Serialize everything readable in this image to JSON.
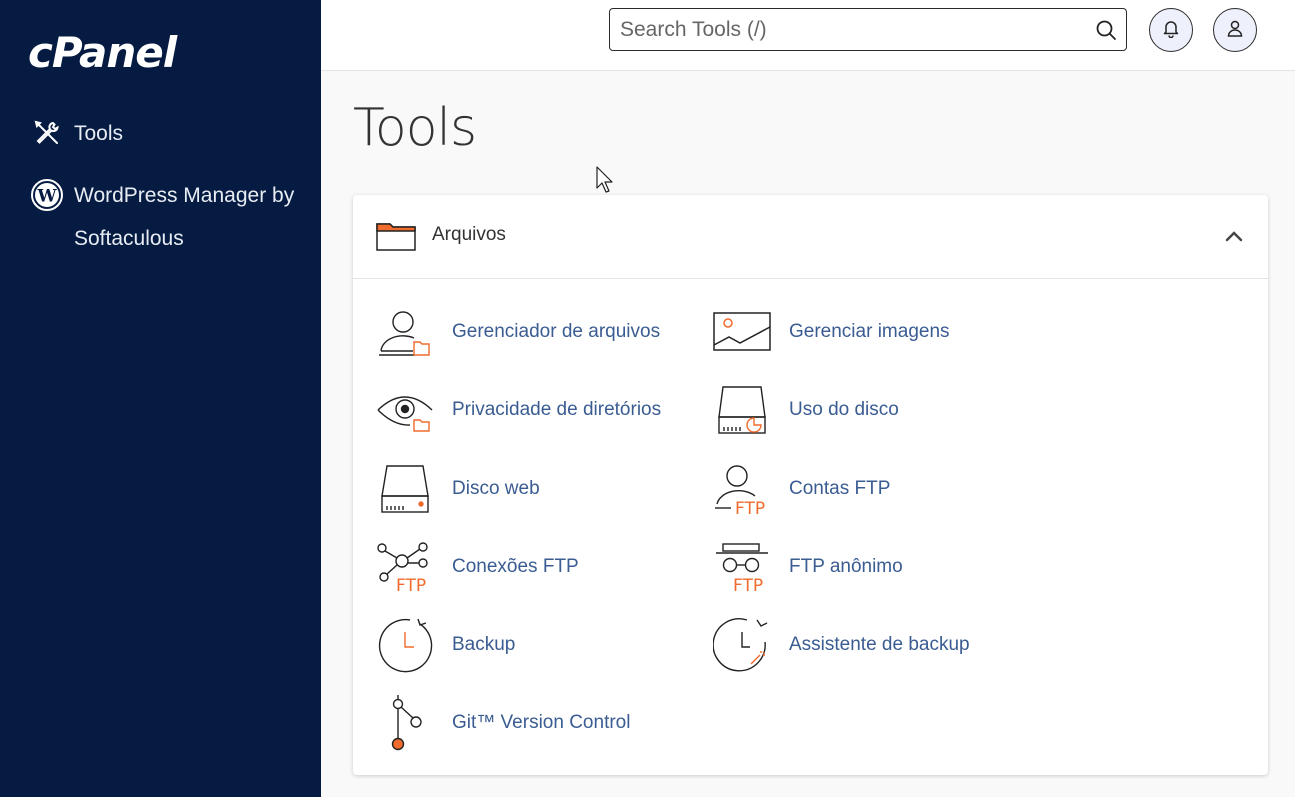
{
  "sidebar": {
    "logo": "cPanel",
    "items": [
      {
        "label": "Tools",
        "icon": "tools-icon"
      },
      {
        "label": "WordPress Manager by Softaculous",
        "icon": "wordpress-icon"
      }
    ]
  },
  "header": {
    "search_placeholder": "Search Tools (/)",
    "bell_icon": "bell-icon",
    "user_icon": "user-icon"
  },
  "page": {
    "title": "Tools"
  },
  "panel": {
    "title": "Arquivos",
    "tools": [
      {
        "label": "Gerenciador de arquivos",
        "icon": "file-manager-icon"
      },
      {
        "label": "Gerenciar imagens",
        "icon": "images-icon"
      },
      {
        "label": "Privacidade de diretórios",
        "icon": "directory-privacy-icon"
      },
      {
        "label": "Uso do disco",
        "icon": "disk-usage-icon"
      },
      {
        "label": "Disco web",
        "icon": "web-disk-icon"
      },
      {
        "label": "Contas FTP",
        "icon": "ftp-accounts-icon"
      },
      {
        "label": "Conexões FTP",
        "icon": "ftp-connections-icon"
      },
      {
        "label": "FTP anônimo",
        "icon": "anonymous-ftp-icon"
      },
      {
        "label": "Backup",
        "icon": "backup-icon"
      },
      {
        "label": "Assistente de backup",
        "icon": "backup-wizard-icon"
      },
      {
        "label": "Git™ Version Control",
        "icon": "git-icon"
      }
    ],
    "ftp_text": "FTP"
  },
  "colors": {
    "sidebar_bg": "#061b42",
    "link": "#3a5c92",
    "accent": "#f06b2d"
  }
}
